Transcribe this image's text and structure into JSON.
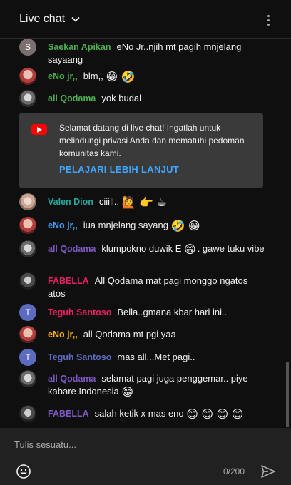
{
  "header": {
    "title": "Live chat"
  },
  "messages": [
    {
      "author": "Saekan Apikan",
      "author_color": "#4caf50",
      "avatar_letter": "S",
      "text": "eNo Jr..njih mt pagih mnjelang sayaang"
    },
    {
      "author": "eNo jr,,",
      "author_color": "#4caf50",
      "text": "blm,,",
      "emoji": "😁 🤣"
    },
    {
      "author": "all Qodama",
      "author_color": "#4caf50",
      "text": "yok budal"
    },
    {
      "author": "Valen Dion",
      "author_color": "#26a69a",
      "text": "ciiill..",
      "emoji": "🙋 👉 ☕"
    },
    {
      "author": "eNo jr,,",
      "author_color": "#3ea6ff",
      "text": "iua mnjelang sayang",
      "emoji": "🤣 😁"
    },
    {
      "author": "all Qodama",
      "author_color": "#7e57c2",
      "text": "klumpokno duwik E",
      "emoji": "😁",
      "text2": ". gawe tuku vibe"
    },
    {
      "author": "FABELLA",
      "author_color": "#e91e63",
      "text": "All Qodama mat pagi monggo ngatos atos"
    },
    {
      "author": "Teguh Santoso",
      "author_color": "#e91e63",
      "avatar_letter": "T",
      "text": "Bella..gmana kbar hari ini.."
    },
    {
      "author": "eNo jr,,",
      "author_color": "#ffb300",
      "text": "all Qodama mt pgi yaa"
    },
    {
      "author": "Teguh Santoso",
      "author_color": "#5c6bc0",
      "avatar_letter": "T",
      "text": "mas all...Met pagi.."
    },
    {
      "author": "all Qodama",
      "author_color": "#7e57c2",
      "text": "selamat pagi juga penggemar.. piye kabare Indonesia",
      "emoji": "😁"
    },
    {
      "author": "FABELLA",
      "author_color": "#7e57c2",
      "text": "salah ketik x mas eno",
      "emoji": "😊 😊 😊 😊"
    }
  ],
  "notice": {
    "text": "Selamat datang di live chat! Ingatlah untuk melindungi privasi Anda dan mematuhi pedoman komunitas kami.",
    "link": "PELAJARI LEBIH LANJUT"
  },
  "composer": {
    "placeholder": "Tulis sesuatu...",
    "counter": "0/200"
  },
  "icons": [
    "chevron-down-icon",
    "more-vert-icon",
    "youtube-icon",
    "emoji-icon",
    "send-icon"
  ]
}
